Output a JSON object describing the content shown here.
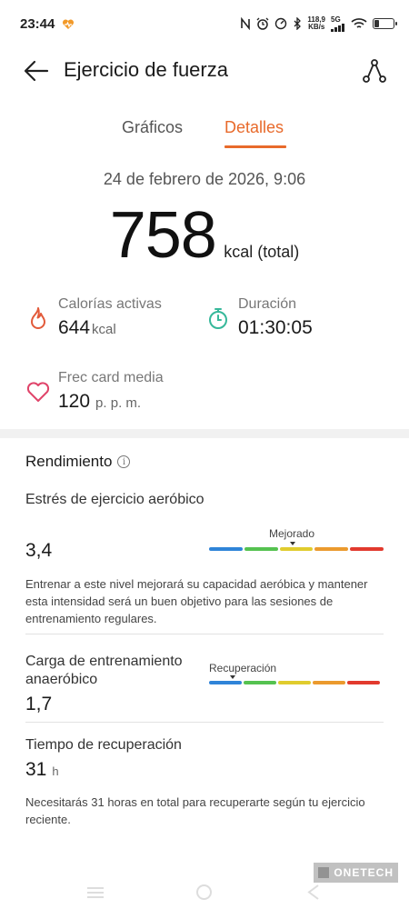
{
  "status_bar": {
    "time": "23:44",
    "net_speed_value": "118,9",
    "net_speed_unit": "KB/s",
    "network": "5G"
  },
  "header": {
    "title": "Ejercicio de fuerza"
  },
  "tabs": [
    {
      "label": "Gráficos",
      "active": false
    },
    {
      "label": "Detalles",
      "active": true
    }
  ],
  "summary": {
    "date": "24 de febrero de 2026, 9:06",
    "total_value": "758",
    "total_unit": "kcal (total)"
  },
  "metrics": {
    "active_calories": {
      "label": "Calorías activas",
      "value": "644",
      "unit": "kcal"
    },
    "duration": {
      "label": "Duración",
      "value": "01:30:05"
    },
    "avg_heart_rate": {
      "label": "Frec card media",
      "value": "120",
      "unit": "p. p. m."
    }
  },
  "performance": {
    "title": "Rendimiento",
    "aerobic": {
      "title": "Estrés de ejercicio aeróbico",
      "value": "3,4",
      "scale_label": "Mejorado",
      "level": 0.48,
      "description": "Entrenar a este nivel mejorará su capacidad aeróbica y mantener esta intensidad será un buen objetivo para las sesiones de entrenamiento regulares."
    },
    "anaerobic": {
      "title": "Carga de entrenamiento anaeróbico",
      "value": "1,7",
      "scale_label": "Recuperación",
      "level": 0.14
    },
    "recovery": {
      "title": "Tiempo de recuperación",
      "value": "31",
      "unit": "h",
      "description": "Necesitarás 31 horas en total para recuperarte según tu ejercicio reciente."
    }
  },
  "scale_colors": [
    "#2f84d8",
    "#55c250",
    "#e0cc2e",
    "#eb9a2e",
    "#e23a2e"
  ],
  "colors": {
    "accent": "#e86a2b",
    "calories_icon": "#e25a3a",
    "duration_icon": "#36b89a",
    "heart_icon": "#e0446a"
  },
  "watermark": "ONETECH"
}
